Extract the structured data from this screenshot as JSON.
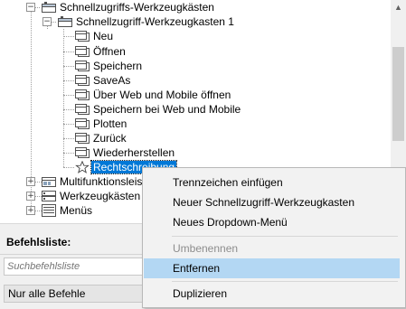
{
  "tree": {
    "root_label": "Schnellzugriffs-Werkzeugkästen",
    "toolbar_label": "Schnellzugriff-Werkzeugkasten 1",
    "commands": [
      {
        "label": "Neu"
      },
      {
        "label": "Öffnen"
      },
      {
        "label": "Speichern"
      },
      {
        "label": "SaveAs"
      },
      {
        "label": "Über Web und Mobile öffnen"
      },
      {
        "label": "Speichern bei Web und Mobile"
      },
      {
        "label": "Plotten"
      },
      {
        "label": "Zurück"
      },
      {
        "label": "Wiederherstellen"
      },
      {
        "label": "Rechtschreibung"
      }
    ],
    "siblings": [
      {
        "label": "Multifunktionsleiste"
      },
      {
        "label": "Werkzeugkästen"
      },
      {
        "label": "Menüs"
      }
    ],
    "expander_open": "−",
    "expander_closed": "+"
  },
  "scrollbar": {
    "up": "▲",
    "down": "▼"
  },
  "command_list": {
    "title": "Befehlsliste:",
    "search_placeholder": "Suchbefehlsliste",
    "filter_value": "Nur alle Befehle"
  },
  "context_menu": {
    "items": [
      {
        "label": "Trennzeichen einfügen",
        "enabled": true
      },
      {
        "label": "Neuer Schnellzugriff-Werkzeugkasten",
        "enabled": true
      },
      {
        "label": "Neues Dropdown-Menü",
        "enabled": true
      },
      {
        "label": "Umbenennen",
        "enabled": false
      },
      {
        "label": "Entfernen",
        "enabled": true,
        "highlighted": true
      },
      {
        "label": "Duplizieren",
        "enabled": true
      }
    ]
  },
  "colors": {
    "selection": "#0078d7",
    "menu_highlight": "#b3d7f3"
  }
}
